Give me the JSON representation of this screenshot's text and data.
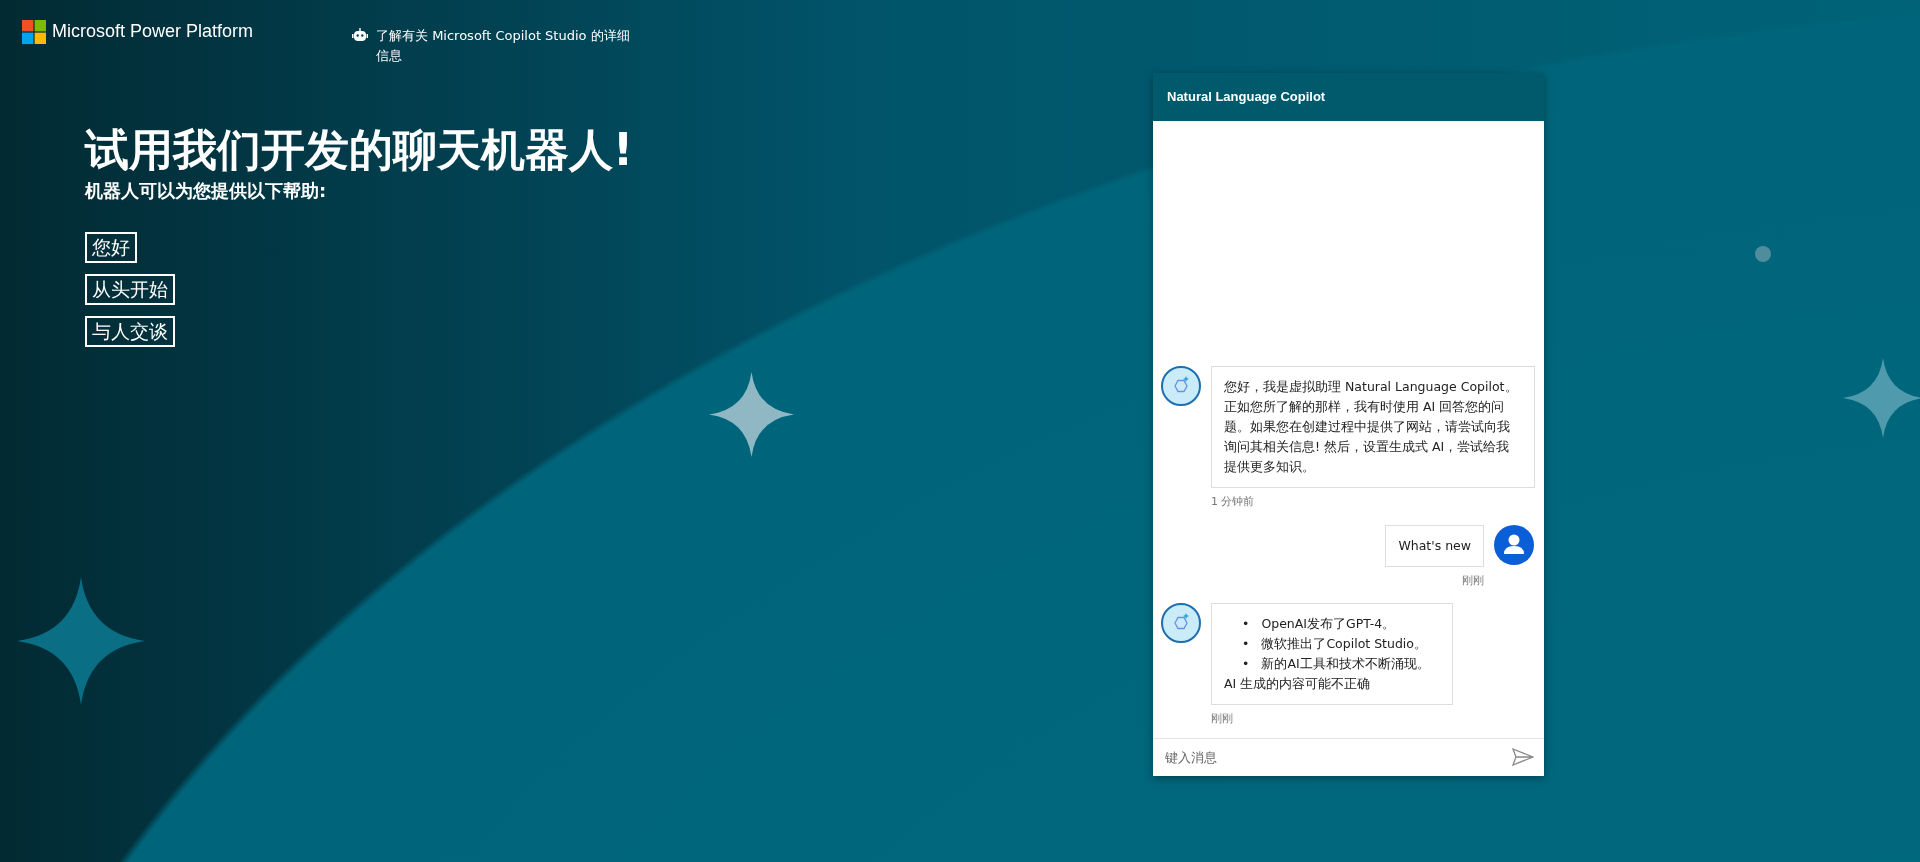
{
  "brand": {
    "name": "Microsoft Power Platform"
  },
  "header_link": {
    "text": "了解有关 Microsoft Copilot Studio 的详细信息"
  },
  "hero": {
    "title": "试用我们开发的聊天机器人!",
    "subtitle": "机器人可以为您提供以下帮助:"
  },
  "topics": [
    "您好",
    "从头开始",
    "与人交谈"
  ],
  "chat": {
    "title": "Natural Language Copilot",
    "messages": [
      {
        "kind": "bot",
        "text": "您好，我是虚拟助理 Natural Language Copilot。正如您所了解的那样，我有时使用 AI 回答您的问题。如果您在创建过程中提供了网站，请尝试向我询问其相关信息! 然后，设置生成式 AI，尝试给我提供更多知识。",
        "time": "1 分钟前"
      },
      {
        "kind": "user",
        "text": "What's new",
        "time": "刚刚"
      },
      {
        "kind": "bot",
        "bullet_marker": "•",
        "bullets": [
          "OpenAI发布了GPT-4。",
          "微软推出了Copilot Studio。",
          "新的AI工具和技术不断涌现。"
        ],
        "text": "AI 生成的内容可能不正确",
        "time": "刚刚"
      }
    ],
    "input": {
      "placeholder": "键入消息"
    }
  }
}
